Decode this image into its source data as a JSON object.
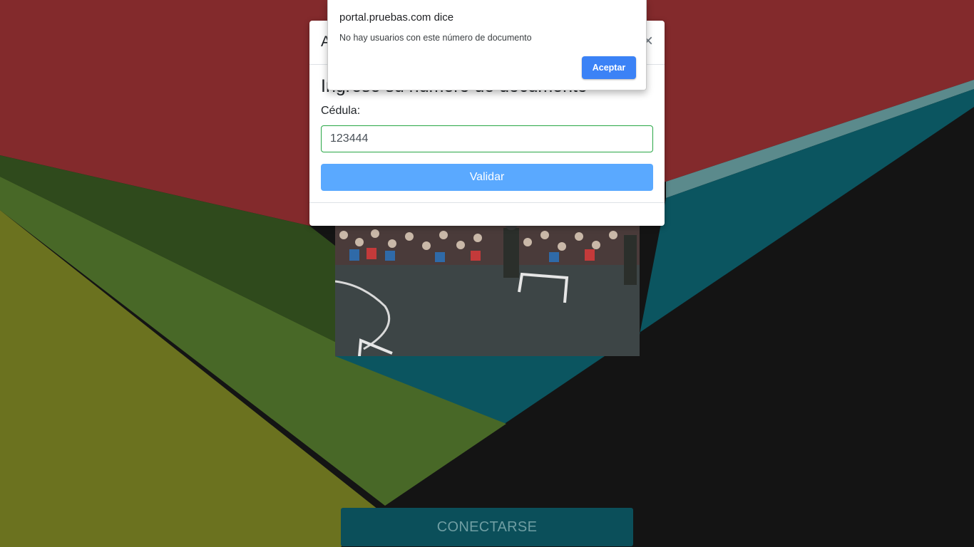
{
  "alert": {
    "title": "portal.pruebas.com dice",
    "message": "No hay usuarios con este número de documento",
    "ok_label": "Aceptar"
  },
  "modal": {
    "title": "A",
    "close_label": "×",
    "heading": "Ingrese su número de documento",
    "field_label": "Cédula:",
    "input_value": "123444",
    "validate_label": "Validar"
  },
  "page": {
    "connect_label": "CONECTARSE"
  },
  "colors": {
    "red": "#832a2c",
    "teal": "#0b5560",
    "olive": "#6b721f",
    "green": "#486827",
    "dark": "#141414",
    "validate_button": "#5aa9ff",
    "alert_button": "#3b82f6",
    "input_border": "#28a745"
  }
}
